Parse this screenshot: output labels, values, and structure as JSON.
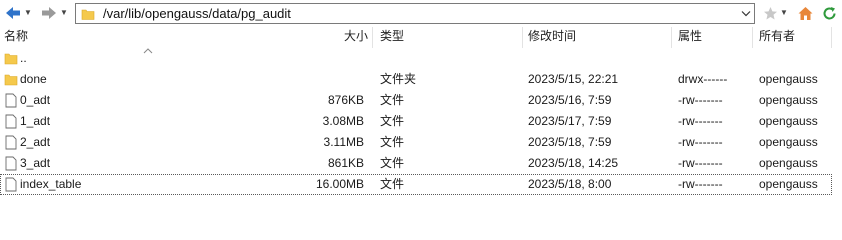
{
  "toolbar": {
    "path": "/var/lib/opengauss/data/pg_audit"
  },
  "columns": {
    "name": "名称",
    "size": "大小",
    "type": "类型",
    "modified": "修改时间",
    "permissions": "属性",
    "owner": "所有者"
  },
  "rows": [
    {
      "icon": "folder-icon",
      "name": "..",
      "size": "",
      "type": "",
      "modified": "",
      "permissions": "",
      "owner": ""
    },
    {
      "icon": "folder-icon",
      "name": "done",
      "size": "",
      "type": "文件夹",
      "modified": "2023/5/15, 22:21",
      "permissions": "drwx------",
      "owner": "opengauss"
    },
    {
      "icon": "file-icon",
      "name": "0_adt",
      "size": "876KB",
      "type": "文件",
      "modified": "2023/5/16, 7:59",
      "permissions": "-rw-------",
      "owner": "opengauss"
    },
    {
      "icon": "file-icon",
      "name": "1_adt",
      "size": "3.08MB",
      "type": "文件",
      "modified": "2023/5/17, 7:59",
      "permissions": "-rw-------",
      "owner": "opengauss"
    },
    {
      "icon": "file-icon",
      "name": "2_adt",
      "size": "3.11MB",
      "type": "文件",
      "modified": "2023/5/18, 7:59",
      "permissions": "-rw-------",
      "owner": "opengauss"
    },
    {
      "icon": "file-icon",
      "name": "3_adt",
      "size": "861KB",
      "type": "文件",
      "modified": "2023/5/18, 14:25",
      "permissions": "-rw-------",
      "owner": "opengauss"
    },
    {
      "icon": "file-icon",
      "name": "index_table",
      "size": "16.00MB",
      "type": "文件",
      "modified": "2023/5/18, 8:00",
      "permissions": "-rw-------",
      "owner": "opengauss",
      "selected": true
    }
  ],
  "colors": {
    "back_arrow": "#2f73c9",
    "forward_arrow": "#9a9a9a",
    "folder": "#f5c94c",
    "star": "#c8c8c8",
    "home": "#e8873a"
  }
}
